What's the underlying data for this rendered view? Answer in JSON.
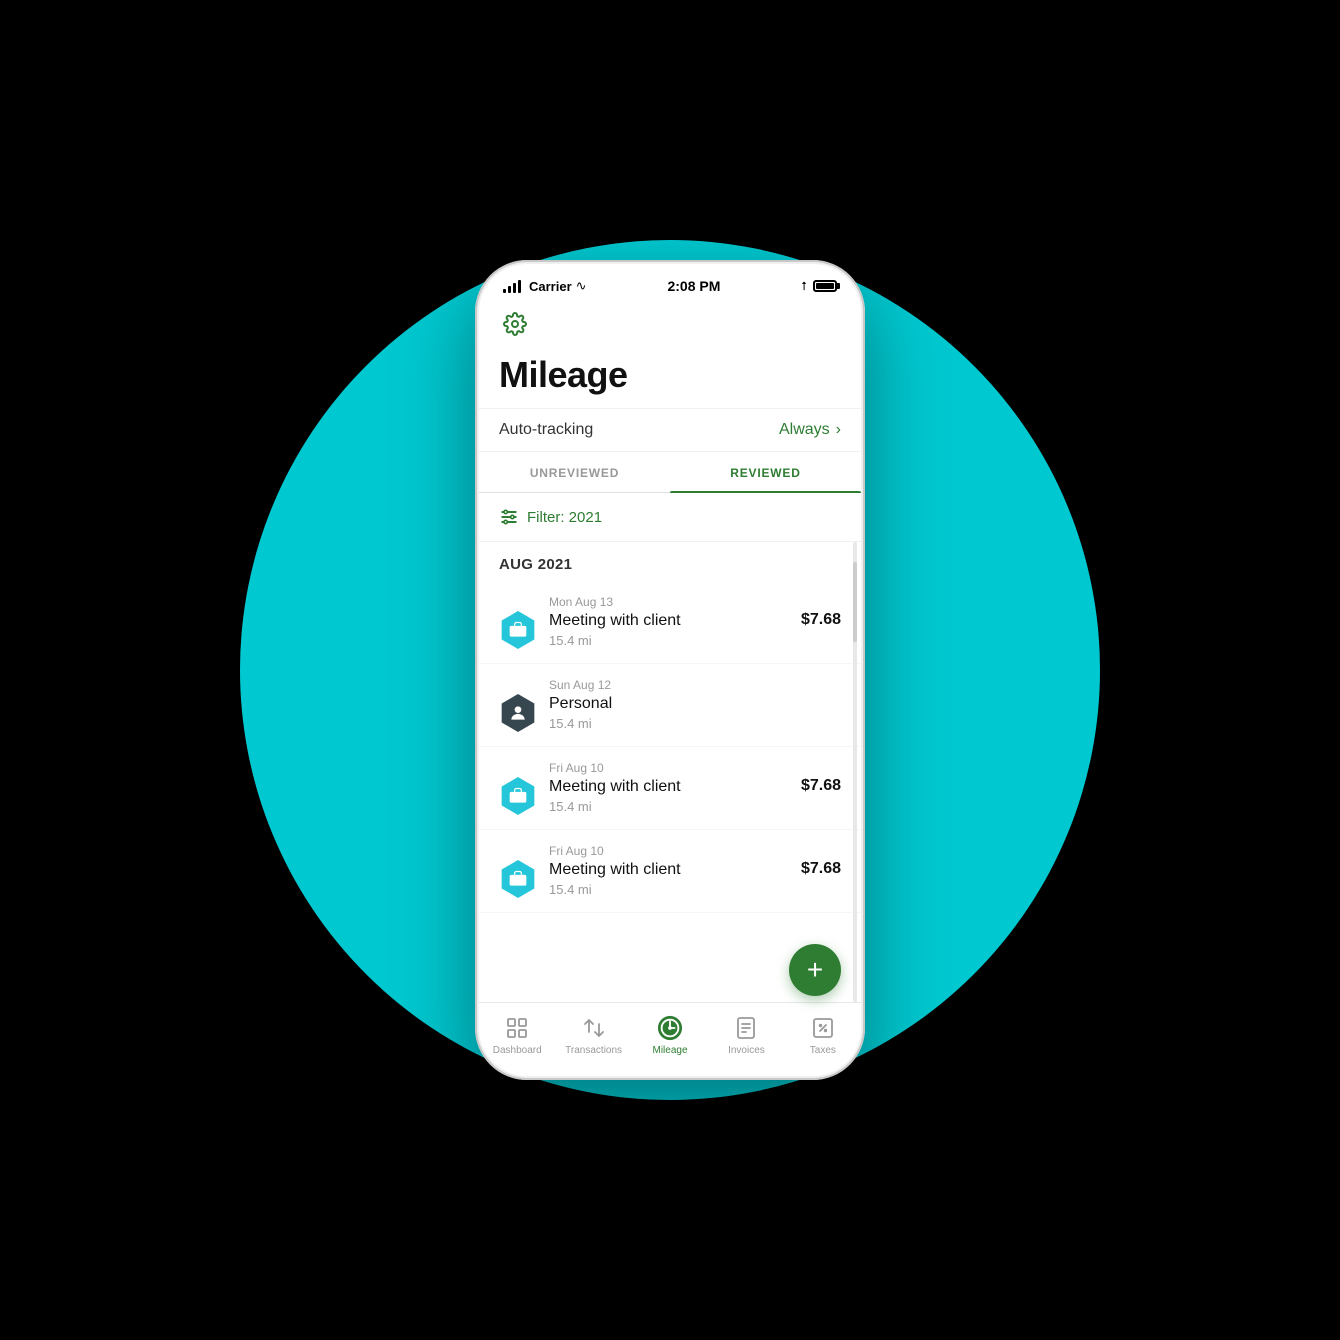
{
  "status_bar": {
    "carrier": "Carrier",
    "time": "2:08 PM",
    "wifi": "wifi",
    "bluetooth": "bluetooth"
  },
  "page": {
    "title": "Mileage",
    "settings_icon": "gear-icon"
  },
  "auto_tracking": {
    "label": "Auto-tracking",
    "value": "Always",
    "chevron": "›"
  },
  "tabs": [
    {
      "id": "unreviewed",
      "label": "UNREVIEWED",
      "active": false
    },
    {
      "id": "reviewed",
      "label": "REVIEWED",
      "active": true
    }
  ],
  "filter": {
    "label": "Filter: 2021"
  },
  "sections": [
    {
      "month": "AUG 2021",
      "trips": [
        {
          "date": "Mon Aug 13",
          "name": "Meeting with client",
          "miles": "15.4 mi",
          "amount": "$7.68",
          "type": "business"
        },
        {
          "date": "Sun Aug 12",
          "name": "Personal",
          "miles": "15.4 mi",
          "amount": "",
          "type": "personal"
        },
        {
          "date": "Fri Aug 10",
          "name": "Meeting with client",
          "miles": "15.4 mi",
          "amount": "$7.68",
          "type": "business"
        },
        {
          "date": "Fri Aug 10",
          "name": "Meeting with client",
          "miles": "15.4 mi",
          "amount": "$7.68",
          "type": "business"
        }
      ]
    }
  ],
  "fab": {
    "label": "+"
  },
  "bottom_nav": [
    {
      "id": "dashboard",
      "label": "Dashboard",
      "active": false
    },
    {
      "id": "transactions",
      "label": "Transactions",
      "active": false
    },
    {
      "id": "mileage",
      "label": "Mileage",
      "active": true
    },
    {
      "id": "invoices",
      "label": "Invoices",
      "active": false
    },
    {
      "id": "taxes",
      "label": "Taxes",
      "active": false
    }
  ]
}
